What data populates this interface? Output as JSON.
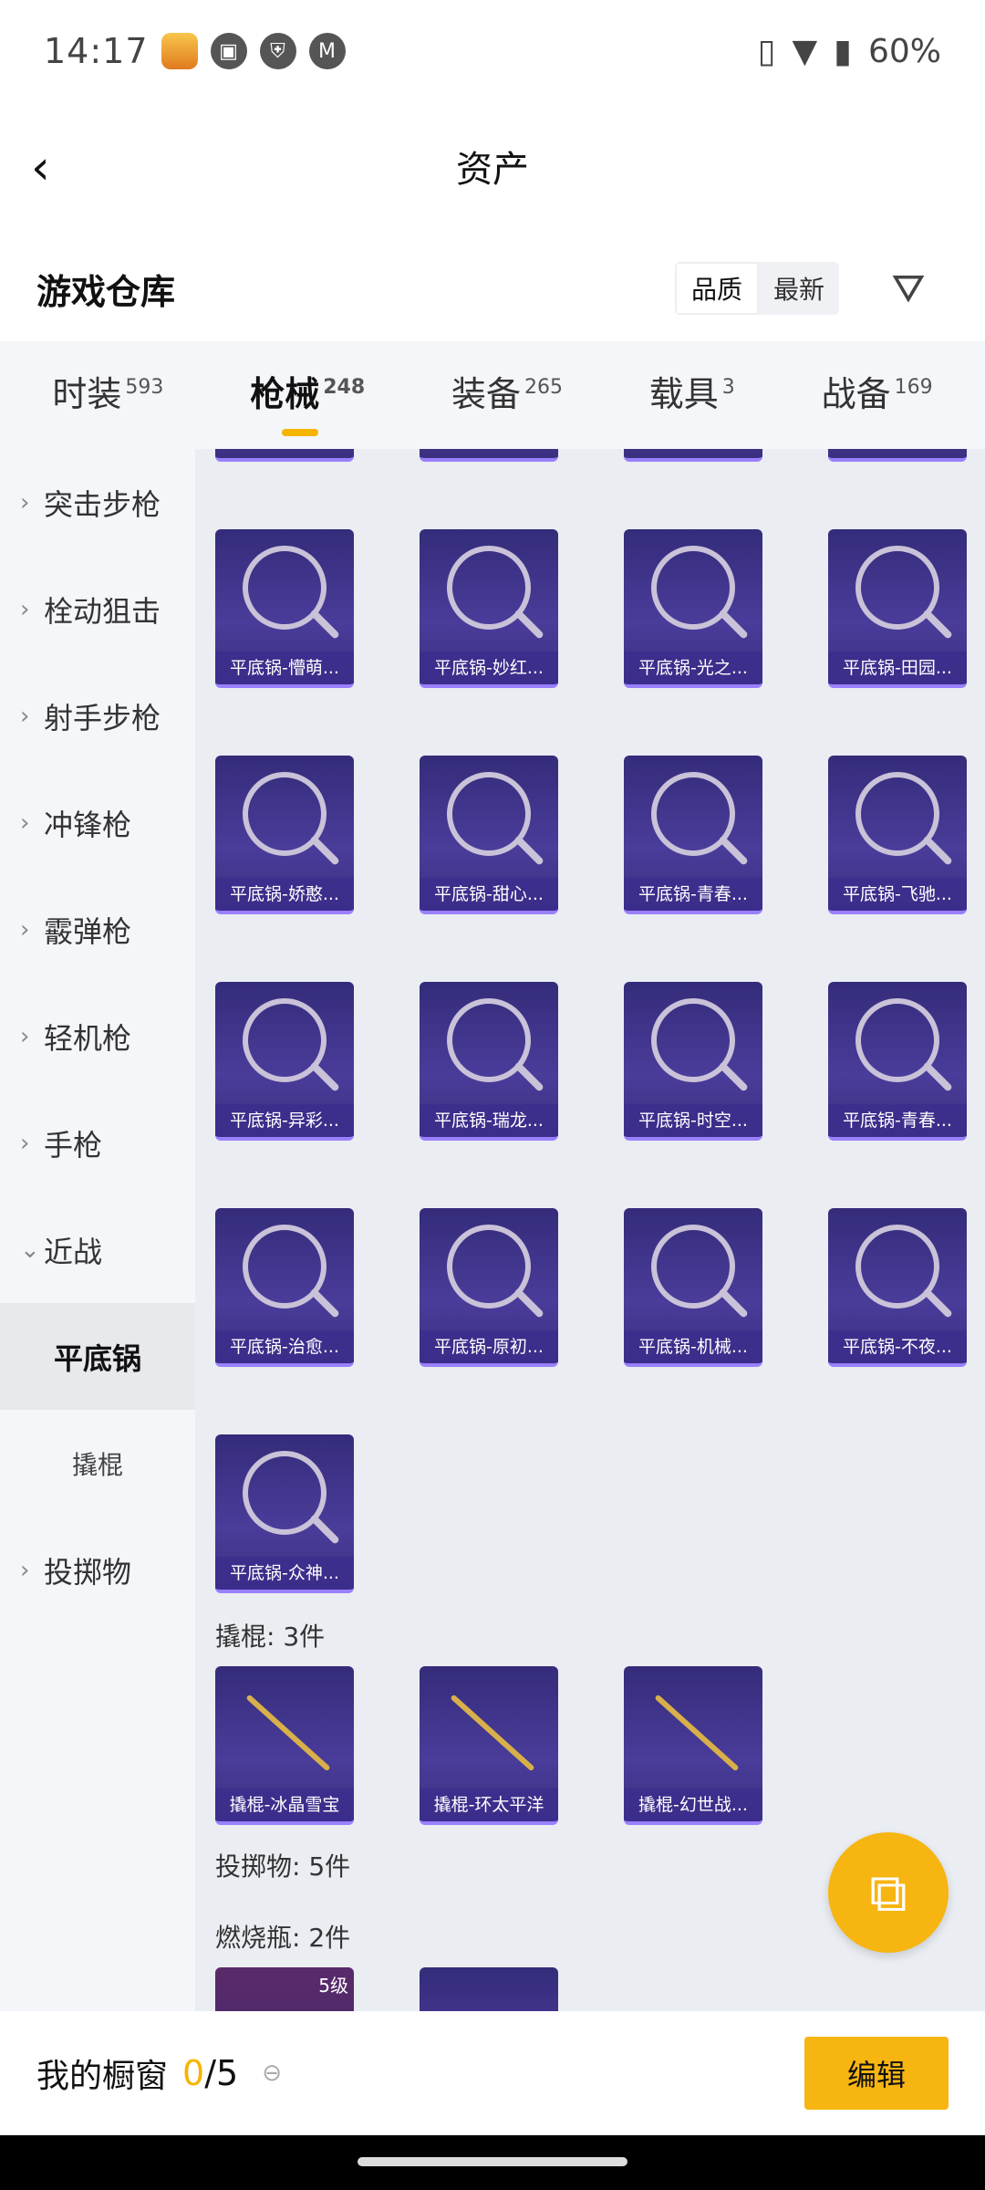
{
  "status": {
    "time": "14:17",
    "battery": "60%"
  },
  "header": {
    "title": "资产"
  },
  "warehouse": {
    "title": "游戏仓库",
    "sort_quality": "品质",
    "sort_latest": "最新"
  },
  "tabs": [
    {
      "label": "时装",
      "count": "593"
    },
    {
      "label": "枪械",
      "count": "248"
    },
    {
      "label": "装备",
      "count": "265"
    },
    {
      "label": "载具",
      "count": "3"
    },
    {
      "label": "战备",
      "count": "169"
    }
  ],
  "categories": [
    {
      "label": "突击步枪"
    },
    {
      "label": "栓动狙击"
    },
    {
      "label": "射手步枪"
    },
    {
      "label": "冲锋枪"
    },
    {
      "label": "霰弹枪"
    },
    {
      "label": "轻机枪"
    },
    {
      "label": "手枪"
    },
    {
      "label": "近战"
    },
    {
      "label": "平底锅"
    },
    {
      "label": "撬棍"
    },
    {
      "label": "投掷物"
    }
  ],
  "pans": [
    "平底锅-懵萌...",
    "平底锅-妙红...",
    "平底锅-光之...",
    "平底锅-田园...",
    "平底锅-娇憨...",
    "平底锅-甜心...",
    "平底锅-青春...",
    "平底锅-飞驰...",
    "平底锅-异彩...",
    "平底锅-瑞龙...",
    "平底锅-时空...",
    "平底锅-青春...",
    "平底锅-治愈...",
    "平底锅-原初...",
    "平底锅-机械...",
    "平底锅-不夜...",
    "平底锅-众神..."
  ],
  "crowbar_title": "撬棍: 3件",
  "crowbars": [
    "撬棍-冰晶雪宝",
    "撬棍-环太平洋",
    "撬棍-幻世战..."
  ],
  "throw_title": "投掷物: 5件",
  "molotov_title": "燃烧瓶: 2件",
  "molotov_level": "5级",
  "showcase": {
    "label": "我的橱窗",
    "current": "0",
    "total": "/5",
    "edit": "编辑"
  },
  "colors": {
    "accent": "#f7b512",
    "card": "#3f3590"
  }
}
